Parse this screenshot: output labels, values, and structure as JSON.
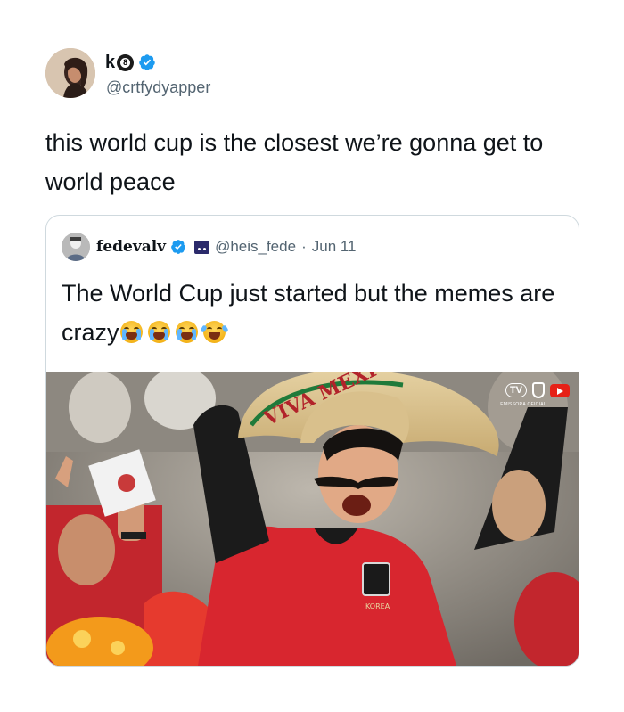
{
  "tweet": {
    "display_name": "k",
    "name_badge": "8",
    "handle": "@crtfydyapper",
    "text": "this world cup is the closest we’re gonna get to world peace",
    "verified_icon": "verified-badge-icon",
    "avatar_icon": "profile-photo"
  },
  "quoted": {
    "display_name": "fedevalv",
    "handle": "@heis_fede",
    "separator": "·",
    "date": "Jun 11",
    "text": "The World Cup just started but the memes are crazy",
    "emojis": [
      "loudly-crying-face",
      "loudly-crying-face",
      "loudly-crying-face",
      "face-with-tears-of-joy"
    ],
    "image_description_icon": "football-fans-photo",
    "broadcast": {
      "tv_label": "TV",
      "sub_label": "EMISSORA OFICIAL"
    },
    "sombrero_text": "VIVA MEXICO",
    "jersey_text": "KOREA"
  },
  "colors": {
    "verified_blue": "#1d9bf0",
    "secondary_text": "#536471",
    "border": "#cfd9de",
    "jersey_red": "#d8262f"
  }
}
